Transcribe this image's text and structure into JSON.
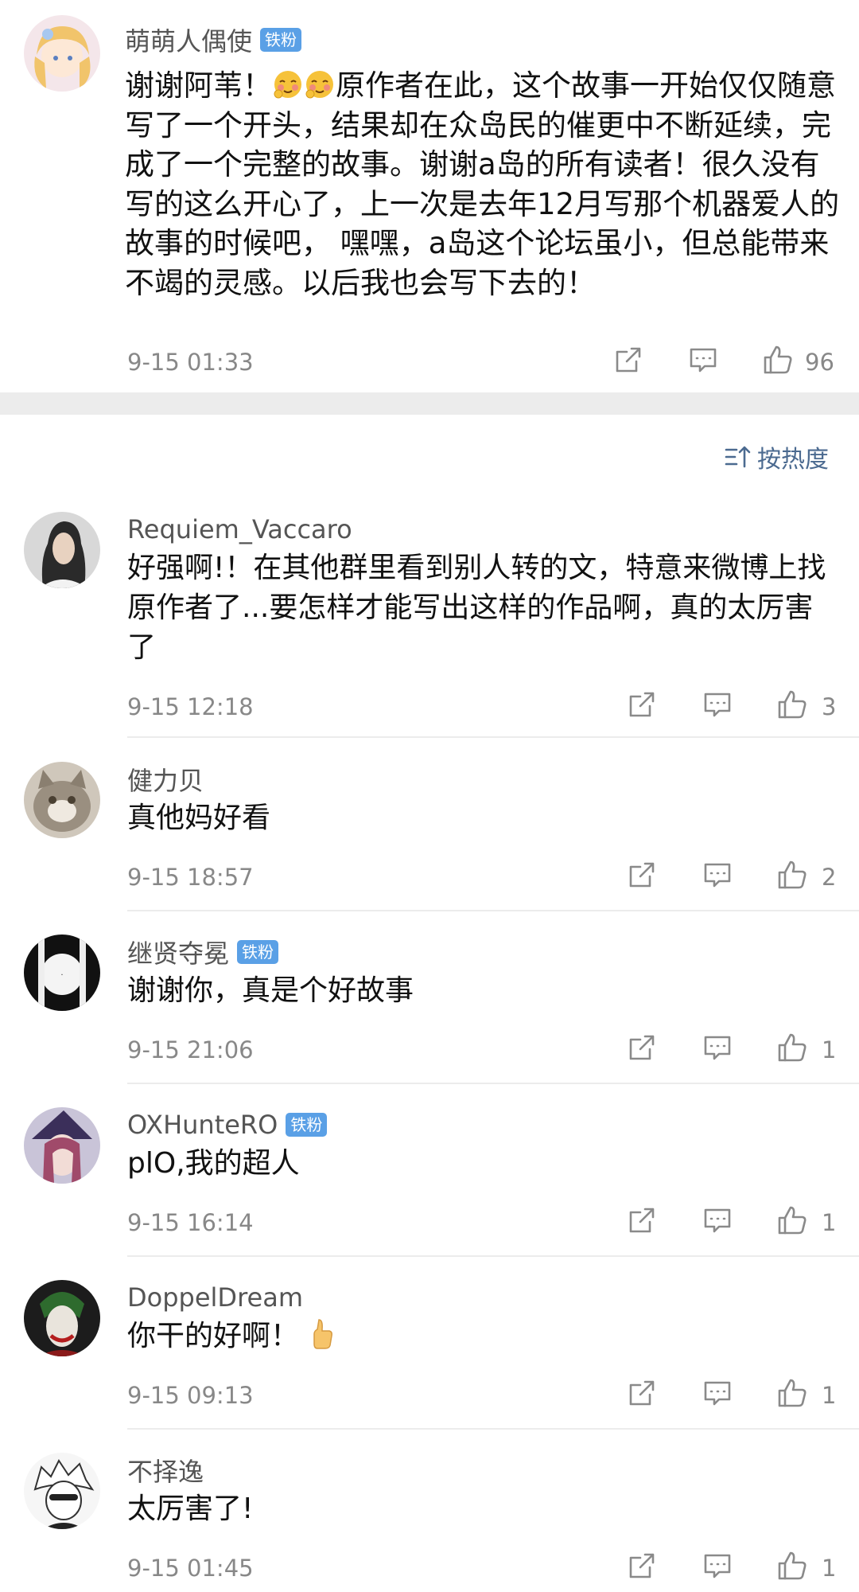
{
  "post": {
    "username": "萌萌人偶使",
    "badge": "铁粉",
    "text_before": "谢谢阿苇！",
    "text_after": "原作者在此，这个故事一开始仅仅随意写了一个开头，结果却在众岛民的催更中不断延续，完成了一个完整的故事。谢谢a岛的所有读者！很久没有写的这么开心了，上一次是去年12月写那个机器爱人的故事的时候吧， 嘿嘿，a岛这个论坛虽小，但总能带来不竭的灵感。以后我也会写下去的！",
    "emoji_icons": [
      "blushing-face-icon",
      "blushing-face-icon"
    ],
    "time": "9-15 01:33",
    "likes": "96"
  },
  "sort": {
    "label": "按热度",
    "icon": "sort-icon"
  },
  "comments": [
    {
      "username": "Requiem_Vaccaro",
      "badge": "",
      "text": "好强啊!！在其他群里看到别人转的文，特意来微博上找原作者了...要怎样才能写出这样的作品啊，真的太厉害了",
      "time": "9-15 12:18",
      "likes": "3"
    },
    {
      "username": "健力贝",
      "badge": "",
      "text": "真他妈好看",
      "time": "9-15 18:57",
      "likes": "2"
    },
    {
      "username": "继贤夺冕",
      "badge": "铁粉",
      "text": "谢谢你，真是个好故事",
      "time": "9-15 21:06",
      "likes": "1"
    },
    {
      "username": "OXHunteRO",
      "badge": "铁粉",
      "text": "plO,我的超人",
      "time": "9-15 16:14",
      "likes": "1"
    },
    {
      "username": "DoppelDream",
      "badge": "",
      "text": "你干的好啊！",
      "emoji": "thumbs-up-icon",
      "time": "9-15 09:13",
      "likes": "1"
    },
    {
      "username": "不择逸",
      "badge": "",
      "text": "太厉害了!",
      "time": "9-15 01:45",
      "likes": "1"
    }
  ],
  "colors": {
    "badge": "#5aa0e6",
    "sort": "#4b6a90",
    "divider": "#ececec",
    "meta": "#888888"
  }
}
